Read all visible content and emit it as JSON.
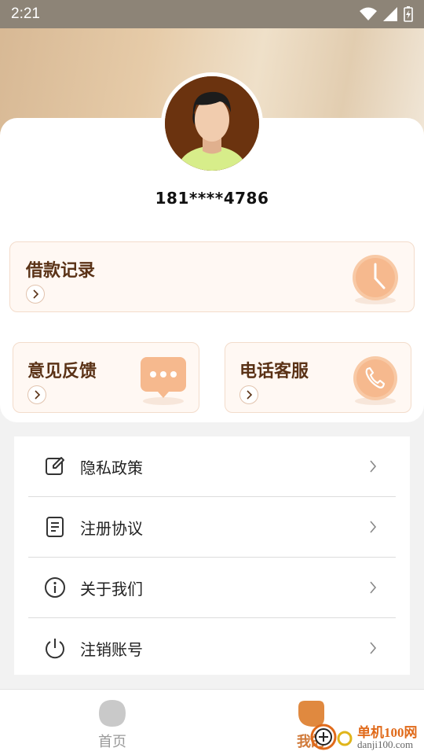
{
  "status": {
    "time": "2:21"
  },
  "profile": {
    "phone": "181****4786"
  },
  "features": {
    "loan_records": "借款记录",
    "feedback": "意见反馈",
    "customer_service": "电话客服"
  },
  "menu": [
    {
      "label": "隐私政策",
      "icon": "edit-icon"
    },
    {
      "label": "注册协议",
      "icon": "document-icon"
    },
    {
      "label": "关于我们",
      "icon": "info-icon"
    },
    {
      "label": "注销账号",
      "icon": "power-icon"
    }
  ],
  "tabbar": {
    "home": "首页",
    "mine": "我的"
  },
  "watermark": {
    "brand": "单机100网",
    "url": "danji100.com"
  },
  "colors": {
    "accent": "#f2a875",
    "title_brown": "#5a3216",
    "tab_active": "#d07a3a",
    "tab_inactive": "#9a9a9a"
  }
}
